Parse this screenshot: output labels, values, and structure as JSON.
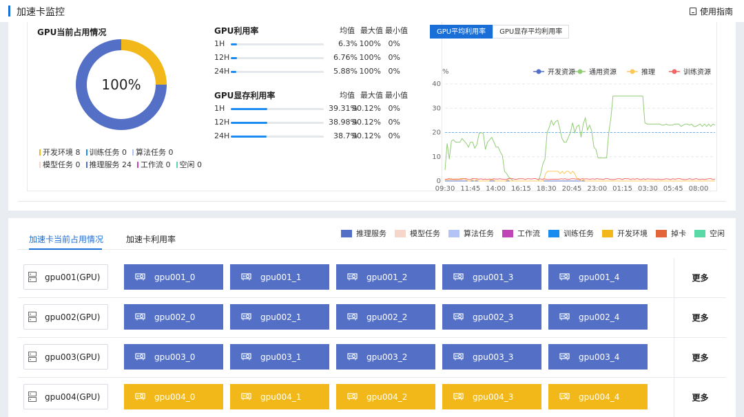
{
  "page": {
    "title": "加速卡监控",
    "guide_label": "使用指南"
  },
  "occupancy": {
    "title": "GPU当前占用情况",
    "center_text": "100%",
    "slices": [
      {
        "label": "开发环境",
        "value": 8,
        "color": "#f2b81a"
      },
      {
        "label": "推理服务",
        "value": 24,
        "color": "#5470c6"
      }
    ],
    "legend": [
      {
        "label": "开发环境 8",
        "color": "#f2b81a"
      },
      {
        "label": "训练任务 0",
        "color": "#1a8cf0"
      },
      {
        "label": "算法任务 0",
        "color": "#b3c3f5"
      },
      {
        "label": "模型任务 0",
        "color": "#f6d6c8"
      },
      {
        "label": "推理服务 24",
        "color": "#5470c6"
      },
      {
        "label": "工作流 0",
        "color": "#c046b8"
      },
      {
        "label": "空闲 0",
        "color": "#5ad8a6"
      }
    ]
  },
  "utilization": {
    "headers": {
      "avg": "均值",
      "max": "最大值",
      "min": "最小值"
    },
    "gpu_util": {
      "title": "GPU利用率",
      "rows": [
        {
          "label": "1H",
          "fill": 0.063,
          "avg": "6.3%",
          "max": "100%",
          "min": "0%"
        },
        {
          "label": "12H",
          "fill": 0.0676,
          "avg": "6.76%",
          "max": "100%",
          "min": "0%"
        },
        {
          "label": "24H",
          "fill": 0.0588,
          "avg": "5.88%",
          "max": "100%",
          "min": "0%"
        }
      ]
    },
    "mem_util": {
      "title": "GPU显存利用率",
      "rows": [
        {
          "label": "1H",
          "fill": 0.3931,
          "avg": "39.31%",
          "max": "90.12%",
          "min": "0%"
        },
        {
          "label": "12H",
          "fill": 0.3898,
          "avg": "38.98%",
          "max": "90.12%",
          "min": "0%"
        },
        {
          "label": "24H",
          "fill": 0.387,
          "avg": "38.7%",
          "max": "90.12%",
          "min": "0%"
        }
      ]
    }
  },
  "trend_tabs": [
    {
      "label": "GPU平均利用率",
      "active": true
    },
    {
      "label": "GPU显存平均利用率",
      "active": false
    }
  ],
  "chart_data": {
    "type": "line",
    "ylabel": "%",
    "ylim": [
      0,
      40
    ],
    "yticks": [
      "0",
      "10",
      "20",
      "30",
      "40"
    ],
    "grid": true,
    "legend_position": "top-right",
    "x_ticks": [
      "09:30",
      "11:45",
      "14:00",
      "16:15",
      "18:30",
      "20:45",
      "23:00",
      "01:15",
      "03:30",
      "05:45",
      "08:00"
    ],
    "reference_line": 20,
    "series": [
      {
        "name": "开发资源",
        "color": "#5470c6",
        "values": [
          0,
          0,
          0,
          0,
          0,
          0,
          0,
          0,
          0,
          0,
          0,
          0,
          0,
          0,
          0,
          0,
          0,
          0,
          0,
          0,
          0,
          0,
          0,
          0,
          0,
          0,
          0,
          0,
          0,
          0,
          0,
          0,
          0,
          0,
          0,
          0,
          0,
          0,
          0,
          0,
          0,
          0,
          0,
          0,
          0,
          0,
          0,
          0,
          0,
          0,
          0,
          0,
          0,
          0,
          0,
          0,
          0,
          0,
          0,
          0,
          0,
          0,
          0,
          0,
          0,
          0,
          0,
          0,
          0,
          0,
          0,
          0,
          0,
          0,
          0,
          0,
          0,
          0,
          0,
          0,
          0,
          0,
          0,
          0,
          0,
          0,
          0,
          0,
          0,
          0,
          0,
          0,
          0,
          0,
          0,
          0,
          0,
          0,
          0,
          0,
          0,
          0,
          0,
          0,
          0,
          0,
          0,
          0,
          0,
          0,
          0,
          0,
          0,
          0,
          0,
          0,
          0,
          0,
          0,
          0
        ]
      },
      {
        "name": "通用资源",
        "color": "#91cc75",
        "values": [
          4.5,
          15.5,
          9,
          16.5,
          17,
          16,
          16,
          16,
          17.5,
          16.5,
          15.5,
          14,
          16,
          16,
          13.5,
          15,
          19.5,
          20,
          19.5,
          13,
          16,
          17,
          18,
          16,
          14,
          14,
          12,
          10.5,
          4,
          3,
          1.5,
          1,
          0,
          0,
          0,
          0,
          0,
          0,
          0,
          0,
          0,
          0,
          0,
          0,
          0,
          3,
          7,
          9,
          20,
          22,
          25,
          23,
          24.5,
          25,
          21.5,
          17.5,
          16,
          16,
          18,
          20,
          24,
          20,
          22.5,
          23,
          18,
          23.5,
          26,
          21,
          23,
          20.5,
          14,
          13,
          9.5,
          9.5,
          9.5,
          9.5,
          9.5,
          20,
          26,
          35,
          35,
          35,
          35,
          35,
          35,
          35,
          35,
          35,
          35,
          35,
          35,
          35,
          35,
          35,
          24,
          23.5,
          23.5,
          23.5,
          23.5,
          23.5,
          23.5,
          23.5,
          23,
          23,
          23.5,
          23,
          23,
          23,
          23.5,
          23.5,
          23.5,
          22.5,
          23,
          23.5,
          23.5,
          23,
          23.5,
          22.5,
          22.5,
          23,
          23.5,
          22.5,
          23.5,
          22.5,
          23.5,
          22.5,
          23.5,
          23
        ]
      },
      {
        "name": "推理",
        "color": "#fac858",
        "values": [
          0.5,
          0.5,
          0.5,
          1,
          0.5,
          0.5,
          0.5,
          1,
          1,
          1,
          0.5,
          0,
          0,
          0.5,
          0,
          0.5,
          0,
          0,
          0,
          0,
          0,
          0,
          0.5,
          0.5,
          0,
          0,
          0,
          0,
          0,
          0,
          0.5,
          0,
          0,
          0,
          0,
          0,
          0,
          0,
          0,
          0,
          0,
          0,
          0,
          0,
          0,
          0,
          0,
          0,
          3,
          4,
          4,
          4,
          4,
          4,
          4,
          3,
          4,
          3,
          4,
          4,
          3,
          4,
          3,
          1,
          1,
          0,
          0.5,
          0,
          0,
          0,
          0,
          0,
          0,
          0,
          0,
          0,
          0,
          0,
          0,
          0,
          0,
          0,
          0,
          0,
          0,
          0,
          0,
          0,
          0,
          0,
          0,
          0,
          0,
          0,
          0,
          0,
          0,
          0,
          0,
          0,
          0,
          0,
          0,
          0,
          0,
          0,
          0,
          0,
          0,
          0,
          0,
          0,
          0,
          0,
          0,
          0,
          0,
          0,
          0,
          0,
          0,
          0,
          0,
          0,
          0,
          0,
          0,
          0,
          0,
          0
        ]
      },
      {
        "name": "训练资源",
        "color": "#ee6666",
        "values": [
          0.7,
          0.8,
          1,
          0.6,
          0.8,
          0.8,
          0.8,
          0.6,
          0.8,
          0.9,
          1,
          0.6,
          0.6,
          1,
          0.9,
          0.9,
          0.7,
          0.9,
          0.6,
          0.8,
          0.6,
          0.8,
          0.6,
          0.9,
          0.8,
          0.8,
          0.9,
          0.8,
          0.7,
          0.6,
          1,
          0.9,
          1,
          0.7,
          0.7,
          0.9,
          0.9,
          0.9,
          0.6,
          0.9,
          0.9,
          0.8,
          1,
          1,
          0.6,
          0.9,
          0.6,
          0.9,
          0.7,
          0.6,
          0.7,
          0.7,
          0.7,
          0.7,
          0.7,
          0.9,
          0.8,
          0.9,
          0.6,
          0.7,
          0.9,
          0.9,
          0.8,
          0.8,
          0.6,
          1,
          0.8,
          0.9,
          0.8,
          0.7,
          0.9,
          0.7,
          1,
          0.8,
          0.8,
          0.6,
          0.9,
          1,
          0.7,
          0.6,
          0.6,
          0.8,
          0.9,
          0.9,
          0.6,
          1,
          0.9,
          0.9,
          0.6,
          0.9,
          0.7,
          1,
          0.7,
          0.6,
          0.9,
          0.6,
          0.9,
          0.8,
          0.8,
          0.8,
          0.6,
          0.8,
          0.6,
          0.6,
          0.8,
          0.9,
          0.8,
          0.6,
          0.9,
          0.7,
          0.9,
          1,
          0.8,
          0.6,
          0.6,
          0.7,
          1,
          0.6,
          0.7,
          1,
          0.7,
          0.6,
          0.8,
          0.6,
          0.8,
          0.9,
          1,
          0.6,
          0.8
        ]
      }
    ]
  },
  "card_tabs": [
    {
      "label": "加速卡当前占用情况",
      "active": true
    },
    {
      "label": "加速卡利用率",
      "active": false
    }
  ],
  "card_legend": [
    {
      "label": "推理服务",
      "color": "#5470c6"
    },
    {
      "label": "模型任务",
      "color": "#f6d6c8"
    },
    {
      "label": "算法任务",
      "color": "#b3c3f5"
    },
    {
      "label": "工作流",
      "color": "#c046b8"
    },
    {
      "label": "训练任务",
      "color": "#1a8cf0"
    },
    {
      "label": "开发环境",
      "color": "#f2b81a"
    },
    {
      "label": "掉卡",
      "color": "#e3663a"
    },
    {
      "label": "空闲",
      "color": "#5ad8a6"
    }
  ],
  "more_label": "更多",
  "nodes": [
    {
      "name": "gpu001(GPU)",
      "color": "#5470c6",
      "cards": [
        "gpu001_0",
        "gpu001_1",
        "gpu001_2",
        "gpu001_3",
        "gpu001_4"
      ]
    },
    {
      "name": "gpu002(GPU)",
      "color": "#5470c6",
      "cards": [
        "gpu002_0",
        "gpu002_1",
        "gpu002_2",
        "gpu002_3",
        "gpu002_4"
      ]
    },
    {
      "name": "gpu003(GPU)",
      "color": "#5470c6",
      "cards": [
        "gpu003_0",
        "gpu003_1",
        "gpu003_2",
        "gpu003_3",
        "gpu003_4"
      ]
    },
    {
      "name": "gpu004(GPU)",
      "color": "#f2b81a",
      "cards": [
        "gpu004_0",
        "gpu004_1",
        "gpu004_2",
        "gpu004_3",
        "gpu004_4"
      ]
    }
  ]
}
